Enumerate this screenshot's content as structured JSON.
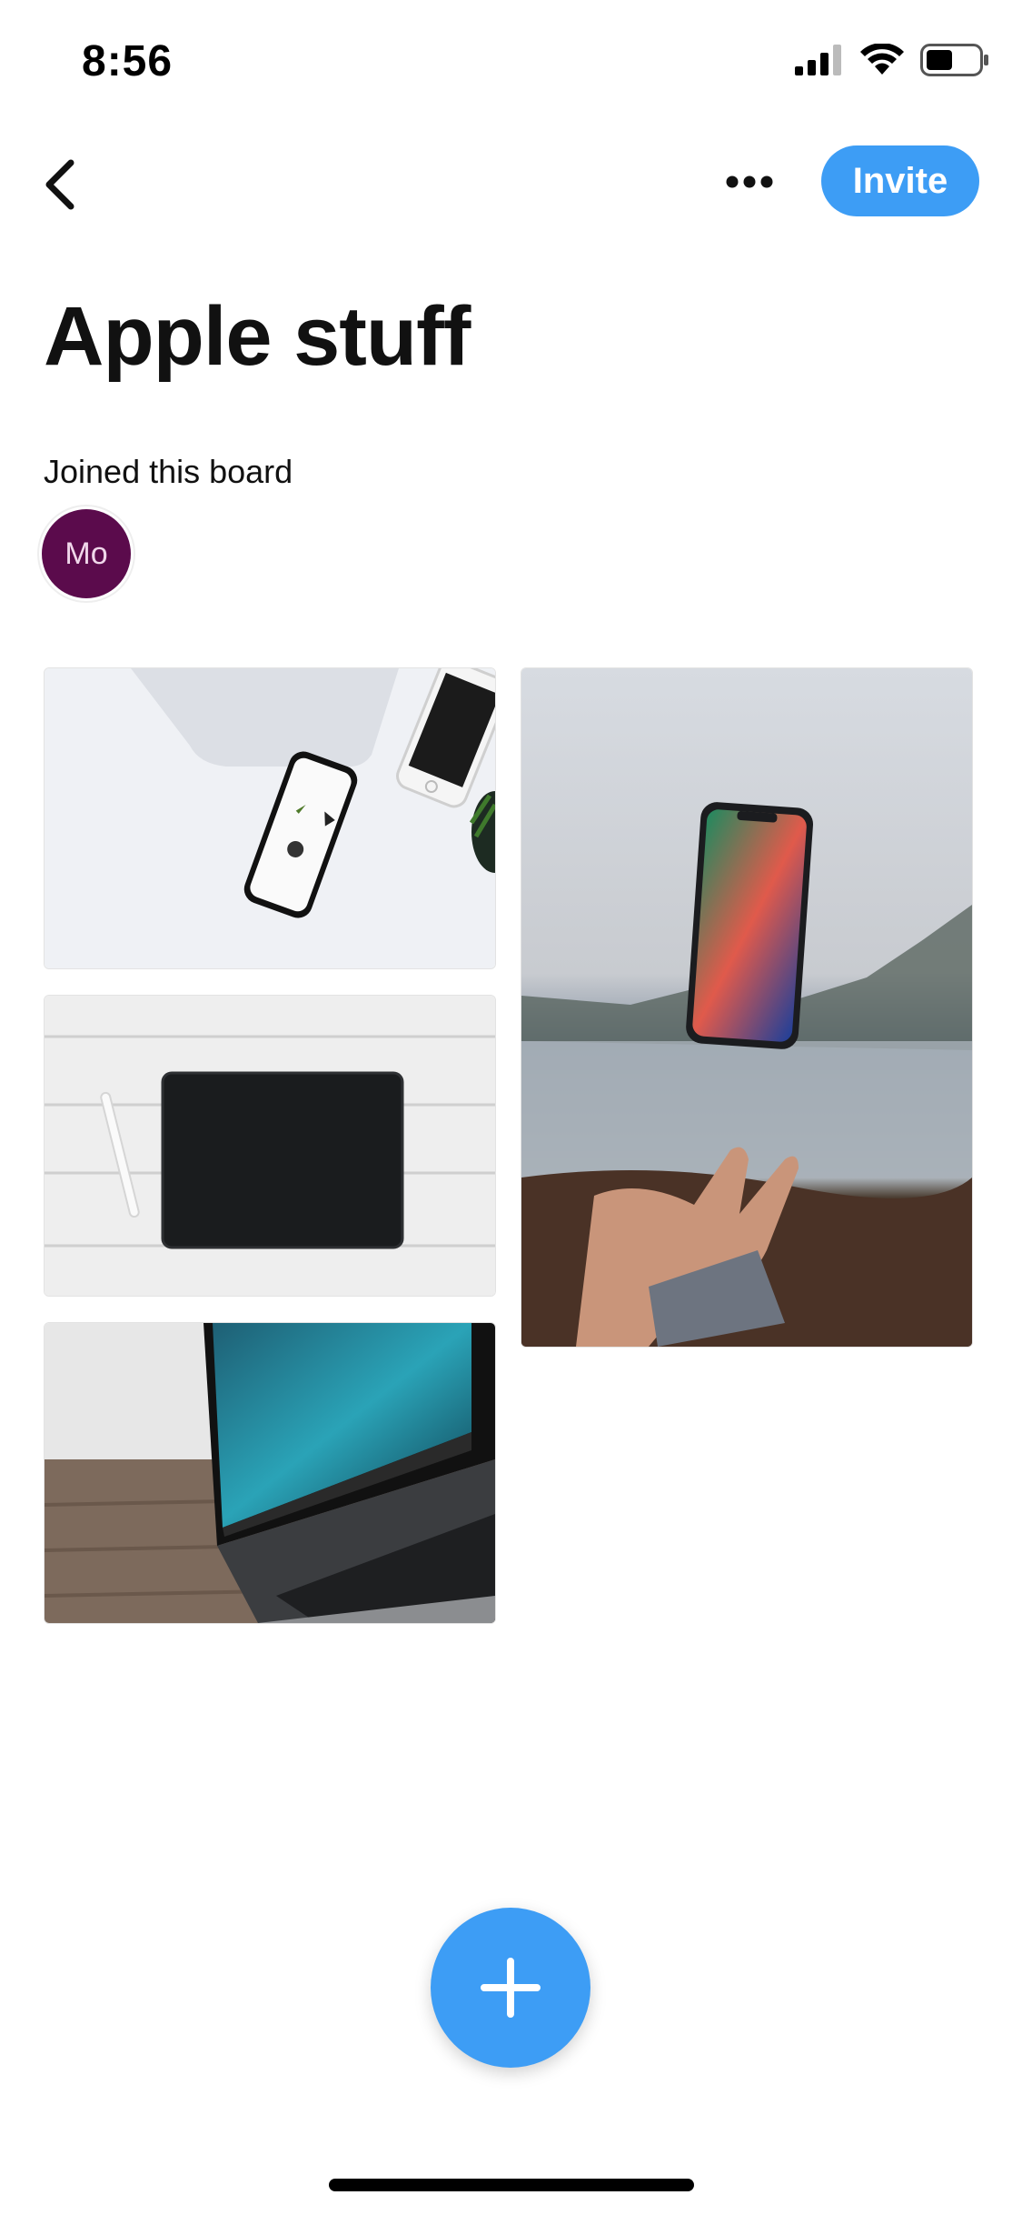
{
  "status_bar": {
    "time": "8:56",
    "icons": [
      "signal-icon",
      "wifi-icon",
      "battery-icon"
    ]
  },
  "nav": {
    "back_icon": "chevron-left-icon",
    "more_icon": "more-horizontal-icon",
    "invite_label": "Invite"
  },
  "board": {
    "title": "Apple stuff",
    "joined_label": "Joined this board",
    "member_initials": "Mo"
  },
  "pins": [
    {
      "name": "pin-iphones-on-desk"
    },
    {
      "name": "pin-ipad-and-pencil"
    },
    {
      "name": "pin-macbook-pro"
    },
    {
      "name": "pin-iphone-x-floating"
    }
  ],
  "fab": {
    "icon": "plus-icon"
  },
  "colors": {
    "accent": "#3d9df5",
    "avatar_bg": "#5b0b4c"
  }
}
